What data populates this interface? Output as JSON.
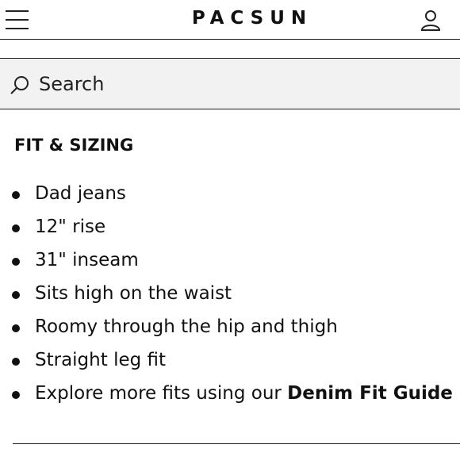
{
  "header": {
    "logo": "PACSUN",
    "menu_icon": "hamburger-menu-icon",
    "account_icon": "user-account-icon"
  },
  "search": {
    "placeholder": "Search",
    "icon": "search-icon"
  },
  "section": {
    "title": "FIT & SIZING",
    "items": [
      {
        "text": "Dad jeans"
      },
      {
        "text": "12\" rise"
      },
      {
        "text": "31\" inseam"
      },
      {
        "text": "Sits high on the waist"
      },
      {
        "text": "Roomy through the hip and thigh"
      },
      {
        "text": "Straight leg fit"
      },
      {
        "text": "Explore more fits using our ",
        "link": "Denim Fit Guide"
      }
    ]
  },
  "colors": {
    "text": "#111111",
    "search_background": "#f2f2f2",
    "rule": "#1a1a1a"
  }
}
